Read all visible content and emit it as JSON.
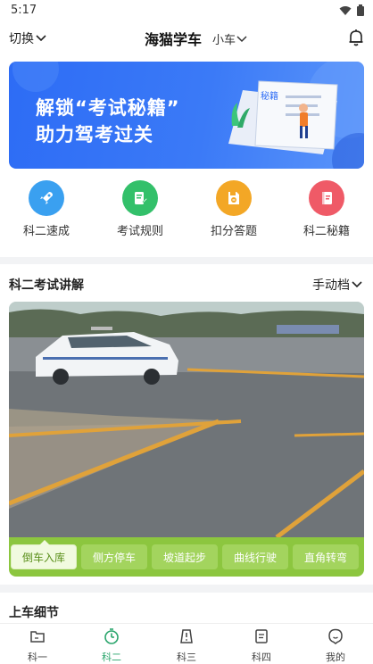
{
  "status": {
    "time": "5:17"
  },
  "header": {
    "switch_label": "切换",
    "title": "海猫学车",
    "car_type": "小车"
  },
  "banner": {
    "line1": "解锁“考试秘籍”",
    "line2": "助力驾考过关",
    "book_text": "秘籍"
  },
  "quick_actions": [
    {
      "label": "科二速成",
      "icon": "rocket-icon",
      "color": "#3aa0f0"
    },
    {
      "label": "考试规则",
      "icon": "document-pen-icon",
      "color": "#33c06a"
    },
    {
      "label": "扣分答题",
      "icon": "floppy-minus-icon",
      "color": "#f3a726"
    },
    {
      "label": "科二秘籍",
      "icon": "book-icon",
      "color": "#ef5a67"
    }
  ],
  "exam_section": {
    "title": "科二考试讲解",
    "gear": "手动档",
    "tabs": [
      "倒车入库",
      "侧方停车",
      "坡道起步",
      "曲线行驶",
      "直角转弯"
    ],
    "active_tab": "倒车入库",
    "accent": "#8cc63f"
  },
  "detail_section": {
    "title": "上车细节"
  },
  "bottom_nav": {
    "items": [
      {
        "label": "科一",
        "icon": "folder-icon"
      },
      {
        "label": "科二",
        "icon": "timer-icon"
      },
      {
        "label": "科三",
        "icon": "road-sign-icon"
      },
      {
        "label": "科四",
        "icon": "note-icon"
      },
      {
        "label": "我的",
        "icon": "profile-icon"
      }
    ],
    "active": "科二",
    "active_color": "#2aa56c"
  }
}
